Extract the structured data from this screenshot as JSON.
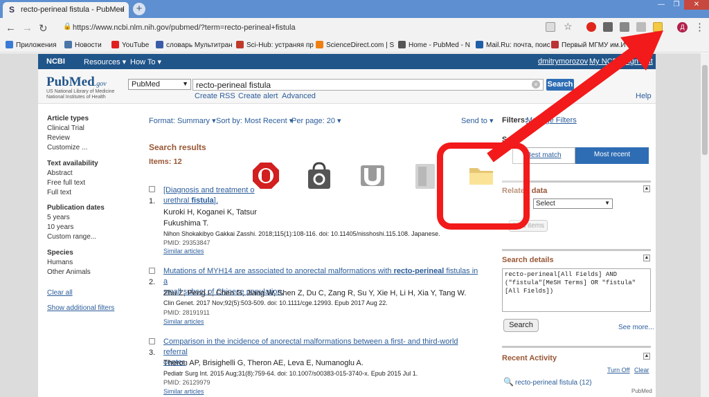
{
  "browser": {
    "tab_title": "recto-perineal fistula - PubMed",
    "tab_close": "×",
    "new_tab": "+",
    "url": "https://www.ncbi.nlm.nih.gov/pubmed/?term=recto-perineal+fistula",
    "profile_initial": "Д",
    "bookmarks": [
      {
        "label": "Приложения",
        "color": "#3a7bd5"
      },
      {
        "label": "Новости",
        "color": "#4a76a8"
      },
      {
        "label": "YouTube",
        "color": "#e02020"
      },
      {
        "label": "словарь Мультитран",
        "color": "#3a5ca8"
      },
      {
        "label": "Sci-Hub: устраняя пр",
        "color": "#c0392b"
      },
      {
        "label": "ScienceDirect.com | S",
        "color": "#f07f13"
      },
      {
        "label": "Home - PubMed - N",
        "color": "#555555"
      },
      {
        "label": "Mail.Ru: почта, поис",
        "color": "#1e5fa8"
      },
      {
        "label": "Первый МГМУ им.И",
        "color": "#b33"
      }
    ]
  },
  "ncbi": {
    "brand": "NCBI",
    "resources": "Resources",
    "howto": "How To",
    "user": "dmitrymorozov",
    "my_ncbi": "My NCBI",
    "sign_out": "Sign Out"
  },
  "header": {
    "logo": "PubMed",
    "logo_suffix": ".gov",
    "logo_sub1": "US National Library of Medicine",
    "logo_sub2": "National Institutes of Health",
    "db": "PubMed",
    "query": "recto-perineal fistula",
    "search_label": "Search",
    "create_rss": "Create RSS",
    "create_alert": "Create alert",
    "advanced": "Advanced",
    "help": "Help"
  },
  "filters_left": {
    "article_types_title": "Article types",
    "article_types": [
      "Clinical Trial",
      "Review",
      "Customize ..."
    ],
    "text_availability_title": "Text availability",
    "text_availability": [
      "Abstract",
      "Free full text",
      "Full text"
    ],
    "pub_dates_title": "Publication dates",
    "pub_dates": [
      "5 years",
      "10 years",
      "Custom range..."
    ],
    "species_title": "Species",
    "species": [
      "Humans",
      "Other Animals"
    ],
    "clear_all": "Clear all",
    "show_additional": "Show additional filters"
  },
  "display": {
    "format": "Format: Summary",
    "sort": "Sort by: Most Recent",
    "per_page": "Per page: 20",
    "send_to": "Send to"
  },
  "results": {
    "title": "Search results",
    "items": "Items: 12",
    "list": [
      {
        "num": "1.",
        "title_line1": "[Diagnosis and treatment o",
        "title_line2_pre": "urethral ",
        "title_line2_bold": "fistula",
        "title_line2_post": "].",
        "authors_line1": "Kuroki H, Koganei K, Tatsur",
        "authors_line2": "Fukushima T.",
        "journal": "Nihon Shokakibyo Gakkai Zasshi. 2018;115(1):108-116. doi: 10.11405/nisshoshi.115.108. Japanese.",
        "pmid": "PMID: 29353847",
        "similar": "Similar articles"
      },
      {
        "num": "2.",
        "title_line1_pre": "Mutations of MYH14 are associated to anorectal malformations with ",
        "title_line1_bold": "recto-perineal",
        "title_line1_post": " fistulas in a",
        "title_line2": "small subset of Chinese population.",
        "authors": "Zhu Z, Peng L, Chen G, Jiang W, Shen Z, Du C, Zang R, Su Y, Xie H, Li H, Xia Y, Tang W.",
        "journal": "Clin Genet. 2017 Nov;92(5):503-509. doi: 10.1111/cge.12993. Epub 2017 Aug 22.",
        "pmid": "PMID: 28191911",
        "similar": "Similar articles"
      },
      {
        "num": "3.",
        "title_line1": "Comparison in the incidence of anorectal malformations between a first- and third-world referral",
        "title_line2": "center.",
        "authors": "Theron AP, Brisighelli G, Theron AE, Leva E, Numanoglu A.",
        "journal": "Pediatr Surg Int. 2015 Aug;31(8):759-64. doi: 10.1007/s00383-015-3740-x. Epub 2015 Jul 1.",
        "pmid": "PMID: 26129979",
        "similar": "Similar articles"
      }
    ]
  },
  "right": {
    "filters_label": "Filters:",
    "manage_filters": "Manage Filters",
    "sort_label_partial": "Sort",
    "best_match_partial": "Best match",
    "most_recent": "Most recent",
    "related_title_partial": "Related data",
    "related_select": "Select",
    "find_items": "Find items",
    "search_details_title": "Search details",
    "search_details_text": "recto-perineal[All Fields] AND (\"fistula\"[MeSH Terms] OR \"fistula\"[All Fields])",
    "search_btn": "Search",
    "see_more": "See more...",
    "recent_activity_title": "Recent Activity",
    "turn_off": "Turn Off",
    "clear": "Clear",
    "recent_item": "recto-perineal fistula (12)",
    "recent_db": "PubMed"
  },
  "colors": {
    "arrow": "#f21a1a",
    "ncbi_bar": "#20558a",
    "link": "#2b5c9a",
    "section_title": "#985735"
  }
}
